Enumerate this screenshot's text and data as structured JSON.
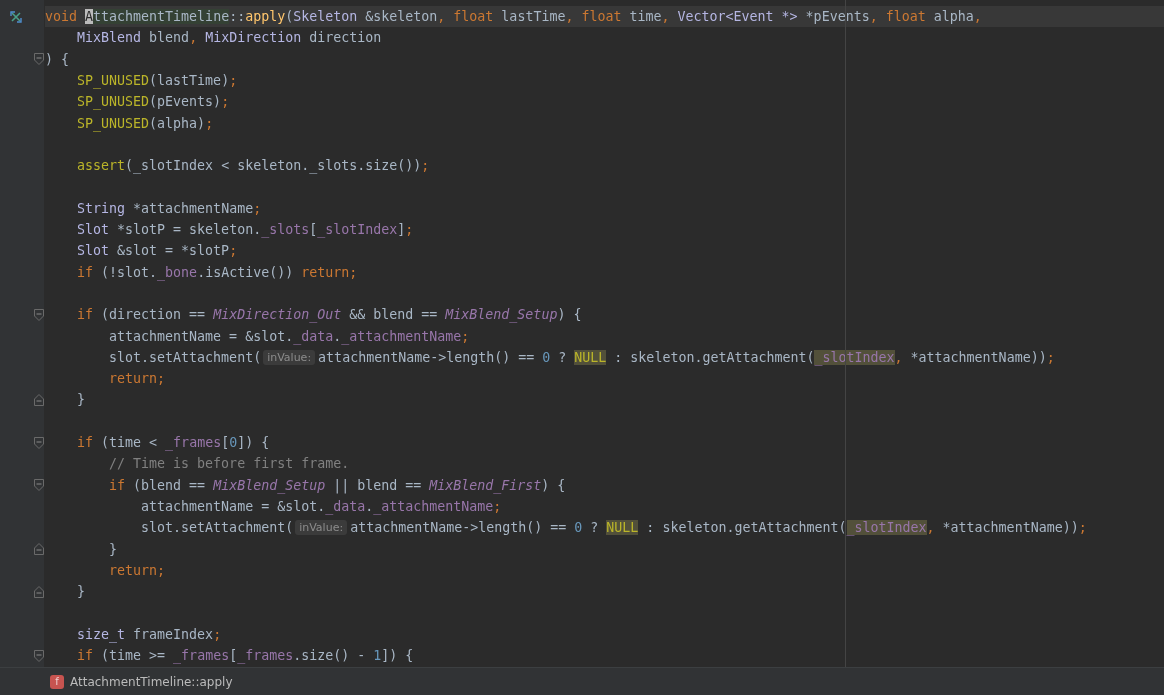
{
  "editor": {
    "lines": [
      {
        "current": true,
        "gutter": {
          "kind": "marker"
        },
        "tokens": [
          {
            "kind": "keyword",
            "text": "void "
          },
          {
            "kind": "caret",
            "text": "A"
          },
          {
            "kind": "usage",
            "text": "ttachmentTimeline"
          },
          {
            "kind": "plain",
            "text": "::"
          },
          {
            "kind": "function",
            "text": "apply"
          },
          {
            "kind": "plain",
            "text": "("
          },
          {
            "kind": "type",
            "text": "Skeleton"
          },
          {
            "kind": "plain",
            "text": " &skeleton"
          },
          {
            "kind": "punct",
            "text": ", "
          },
          {
            "kind": "keyword",
            "text": "float"
          },
          {
            "kind": "plain",
            "text": " lastTime"
          },
          {
            "kind": "punct",
            "text": ", "
          },
          {
            "kind": "keyword",
            "text": "float"
          },
          {
            "kind": "plain",
            "text": " time"
          },
          {
            "kind": "punct",
            "text": ", "
          },
          {
            "kind": "type",
            "text": "Vector<Event *>"
          },
          {
            "kind": "plain",
            "text": " *pEvents"
          },
          {
            "kind": "punct",
            "text": ", "
          },
          {
            "kind": "keyword",
            "text": "float"
          },
          {
            "kind": "plain",
            "text": " alpha"
          },
          {
            "kind": "punct",
            "text": ","
          }
        ]
      },
      {
        "current": false,
        "tokens": [
          {
            "kind": "type",
            "text": "    MixBlend"
          },
          {
            "kind": "plain",
            "text": " blend"
          },
          {
            "kind": "punct",
            "text": ", "
          },
          {
            "kind": "type",
            "text": "MixDirection"
          },
          {
            "kind": "plain",
            "text": " direction"
          }
        ]
      },
      {
        "current": false,
        "gutter": {
          "kind": "fold-start"
        },
        "tokens": [
          {
            "kind": "plain",
            "text": ") {"
          }
        ]
      },
      {
        "current": false,
        "tokens": [
          {
            "kind": "macro",
            "text": "    SP_UNUSED"
          },
          {
            "kind": "plain",
            "text": "(lastTime)"
          },
          {
            "kind": "punct",
            "text": ";"
          }
        ]
      },
      {
        "current": false,
        "tokens": [
          {
            "kind": "macro",
            "text": "    SP_UNUSED"
          },
          {
            "kind": "plain",
            "text": "(pEvents)"
          },
          {
            "kind": "punct",
            "text": ";"
          }
        ]
      },
      {
        "current": false,
        "tokens": [
          {
            "kind": "macro",
            "text": "    SP_UNUSED"
          },
          {
            "kind": "plain",
            "text": "(alpha)"
          },
          {
            "kind": "punct",
            "text": ";"
          }
        ]
      },
      {
        "current": false
      },
      {
        "current": false,
        "tokens": [
          {
            "kind": "macro",
            "text": "    assert"
          },
          {
            "kind": "plain",
            "text": "(_slotIndex < skeleton._slots.size())"
          },
          {
            "kind": "punct",
            "text": ";"
          }
        ]
      },
      {
        "current": false
      },
      {
        "current": false,
        "tokens": [
          {
            "kind": "type",
            "text": "    String"
          },
          {
            "kind": "plain",
            "text": " *attachmentName"
          },
          {
            "kind": "punct",
            "text": ";"
          }
        ]
      },
      {
        "current": false,
        "tokens": [
          {
            "kind": "type",
            "text": "    Slot"
          },
          {
            "kind": "plain",
            "text": " *slotP = skeleton."
          },
          {
            "kind": "field",
            "text": "_slots"
          },
          {
            "kind": "plain",
            "text": "["
          },
          {
            "kind": "field",
            "text": "_slotIndex"
          },
          {
            "kind": "plain",
            "text": "]"
          },
          {
            "kind": "punct",
            "text": ";"
          }
        ]
      },
      {
        "current": false,
        "tokens": [
          {
            "kind": "type",
            "text": "    Slot"
          },
          {
            "kind": "plain",
            "text": " &slot = *slotP"
          },
          {
            "kind": "punct",
            "text": ";"
          }
        ]
      },
      {
        "current": false,
        "tokens": [
          {
            "kind": "keyword",
            "text": "    if"
          },
          {
            "kind": "plain",
            "text": " (!slot."
          },
          {
            "kind": "field",
            "text": "_bone"
          },
          {
            "kind": "plain",
            "text": ".isActive()) "
          },
          {
            "kind": "keyword",
            "text": "return"
          },
          {
            "kind": "punct",
            "text": ";"
          }
        ]
      },
      {
        "current": false
      },
      {
        "current": false,
        "gutter": {
          "kind": "fold-start"
        },
        "tokens": [
          {
            "kind": "keyword",
            "text": "    if"
          },
          {
            "kind": "plain",
            "text": " (direction == "
          },
          {
            "kind": "enum",
            "text": "MixDirection_Out"
          },
          {
            "kind": "plain",
            "text": " && blend == "
          },
          {
            "kind": "enum",
            "text": "MixBlend_Setup"
          },
          {
            "kind": "plain",
            "text": ") {"
          }
        ]
      },
      {
        "current": false,
        "tokens": [
          {
            "kind": "plain",
            "text": "        attachmentName = &slot."
          },
          {
            "kind": "field",
            "text": "_data"
          },
          {
            "kind": "plain",
            "text": "."
          },
          {
            "kind": "field",
            "text": "_attachmentName"
          },
          {
            "kind": "punct",
            "text": ";"
          }
        ]
      },
      {
        "current": false,
        "tokens": [
          {
            "kind": "plain",
            "text": "        slot.setAttachment("
          },
          {
            "kind": "hint",
            "text": "inValue:"
          },
          {
            "kind": "plain",
            "text": "attachmentName->length() == "
          },
          {
            "kind": "number",
            "text": "0"
          },
          {
            "kind": "plain",
            "text": " ? "
          },
          {
            "kind": "macro",
            "text": "NULL",
            "highlighted": true
          },
          {
            "kind": "plain",
            "text": " : skeleton.getAttachment("
          },
          {
            "kind": "field",
            "text": "_slotIndex",
            "highlighted": true
          },
          {
            "kind": "punct",
            "text": ", "
          },
          {
            "kind": "plain",
            "text": "*attachmentName))"
          },
          {
            "kind": "punct",
            "text": ";"
          }
        ]
      },
      {
        "current": false,
        "tokens": [
          {
            "kind": "keyword",
            "text": "        return"
          },
          {
            "kind": "punct",
            "text": ";"
          }
        ]
      },
      {
        "current": false,
        "gutter": {
          "kind": "fold-end"
        },
        "tokens": [
          {
            "kind": "plain",
            "text": "    }"
          }
        ]
      },
      {
        "current": false
      },
      {
        "current": false,
        "gutter": {
          "kind": "fold-start"
        },
        "tokens": [
          {
            "kind": "keyword",
            "text": "    if"
          },
          {
            "kind": "plain",
            "text": " (time < "
          },
          {
            "kind": "field",
            "text": "_frames"
          },
          {
            "kind": "plain",
            "text": "["
          },
          {
            "kind": "number",
            "text": "0"
          },
          {
            "kind": "plain",
            "text": "]) {"
          }
        ]
      },
      {
        "current": false,
        "tokens": [
          {
            "kind": "comment",
            "text": "        // Time is before first frame."
          }
        ]
      },
      {
        "current": false,
        "gutter": {
          "kind": "fold-start"
        },
        "tokens": [
          {
            "kind": "keyword",
            "text": "        if"
          },
          {
            "kind": "plain",
            "text": " (blend == "
          },
          {
            "kind": "enum",
            "text": "MixBlend_Setup"
          },
          {
            "kind": "plain",
            "text": " || blend == "
          },
          {
            "kind": "enum",
            "text": "MixBlend_First"
          },
          {
            "kind": "plain",
            "text": ") {"
          }
        ]
      },
      {
        "current": false,
        "tokens": [
          {
            "kind": "plain",
            "text": "            attachmentName = &slot."
          },
          {
            "kind": "field",
            "text": "_data"
          },
          {
            "kind": "plain",
            "text": "."
          },
          {
            "kind": "field",
            "text": "_attachmentName"
          },
          {
            "kind": "punct",
            "text": ";"
          }
        ]
      },
      {
        "current": false,
        "tokens": [
          {
            "kind": "plain",
            "text": "            slot.setAttachment("
          },
          {
            "kind": "hint",
            "text": "inValue:"
          },
          {
            "kind": "plain",
            "text": "attachmentName->length() == "
          },
          {
            "kind": "number",
            "text": "0"
          },
          {
            "kind": "plain",
            "text": " ? "
          },
          {
            "kind": "macro",
            "text": "NULL",
            "highlighted": true
          },
          {
            "kind": "plain",
            "text": " : skeleton.getAttachment("
          },
          {
            "kind": "field",
            "text": "_slotIndex",
            "highlighted": true
          },
          {
            "kind": "punct",
            "text": ", "
          },
          {
            "kind": "plain",
            "text": "*attachmentName))"
          },
          {
            "kind": "punct",
            "text": ";"
          }
        ]
      },
      {
        "current": false,
        "gutter": {
          "kind": "fold-end"
        },
        "tokens": [
          {
            "kind": "plain",
            "text": "        }"
          }
        ]
      },
      {
        "current": false,
        "tokens": [
          {
            "kind": "keyword",
            "text": "        return"
          },
          {
            "kind": "punct",
            "text": ";"
          }
        ]
      },
      {
        "current": false,
        "gutter": {
          "kind": "fold-end"
        },
        "tokens": [
          {
            "kind": "plain",
            "text": "    }"
          }
        ]
      },
      {
        "current": false
      },
      {
        "current": false,
        "tokens": [
          {
            "kind": "type",
            "text": "    size_t"
          },
          {
            "kind": "plain",
            "text": " frameIndex"
          },
          {
            "kind": "punct",
            "text": ";"
          }
        ]
      },
      {
        "current": false,
        "gutter": {
          "kind": "fold-start"
        },
        "tokens": [
          {
            "kind": "keyword",
            "text": "    if"
          },
          {
            "kind": "plain",
            "text": " (time >= "
          },
          {
            "kind": "field",
            "text": "_frames"
          },
          {
            "kind": "plain",
            "text": "["
          },
          {
            "kind": "field",
            "text": "_frames"
          },
          {
            "kind": "plain",
            "text": ".size() - "
          },
          {
            "kind": "number",
            "text": "1"
          },
          {
            "kind": "plain",
            "text": "]) {"
          }
        ]
      }
    ]
  },
  "breadcrumb": {
    "icon_letter": "f",
    "label": "AttachmentTimeline::apply"
  }
}
